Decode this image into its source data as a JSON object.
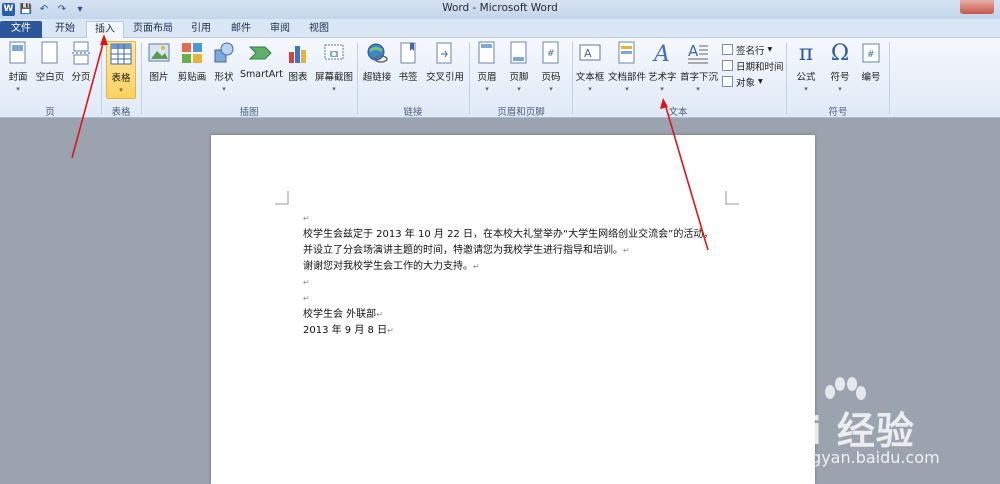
{
  "window": {
    "title": "Word - Microsoft Word"
  },
  "qat": {
    "logo": "W"
  },
  "tabs": [
    {
      "label": "文件"
    },
    {
      "label": "开始"
    },
    {
      "label": "插入"
    },
    {
      "label": "页面布局"
    },
    {
      "label": "引用"
    },
    {
      "label": "邮件"
    },
    {
      "label": "审阅"
    },
    {
      "label": "视图"
    }
  ],
  "ribbon": {
    "pages": {
      "cover": "封面",
      "blank": "空白页",
      "break": "分页",
      "group": "页"
    },
    "table": {
      "table": "表格",
      "group": "表格"
    },
    "illustrations": {
      "picture": "图片",
      "clipart": "剪贴画",
      "shapes": "形状",
      "smartart": "SmartArt",
      "chart": "图表",
      "screenshot": "屏幕截图",
      "group": "插图"
    },
    "links": {
      "hyperlink": "超链接",
      "bookmark": "书签",
      "crossref": "交叉引用",
      "group": "链接"
    },
    "headerfooter": {
      "header": "页眉",
      "footer": "页脚",
      "pagenum": "页码",
      "group": "页眉和页脚"
    },
    "text": {
      "textbox": "文本框",
      "quickparts": "文档部件",
      "wordart": "艺术字",
      "dropcap": "首字下沉",
      "signature": "签名行",
      "datetime": "日期和时间",
      "object": "对象",
      "group": "文本"
    },
    "symbols": {
      "equation": "公式",
      "symbol": "符号",
      "number": "编号",
      "group": "符号"
    }
  },
  "document": {
    "paragraphs": [
      "",
      "校学生会兹定于 2013 年 10 月 22 日，在本校大礼堂举办“大学生网络创业交流会”的活动，",
      "并设立了分会场演讲主题的时间，特邀请您为我校学生进行指导和培训。",
      "谢谢您对我校学生会工作的大力支持。",
      "",
      "",
      "校学生会 外联部",
      "2013 年 9 月 8 日"
    ]
  },
  "watermark": {
    "brand": "Bai 经验",
    "url": "jingyan.baidu.com"
  }
}
